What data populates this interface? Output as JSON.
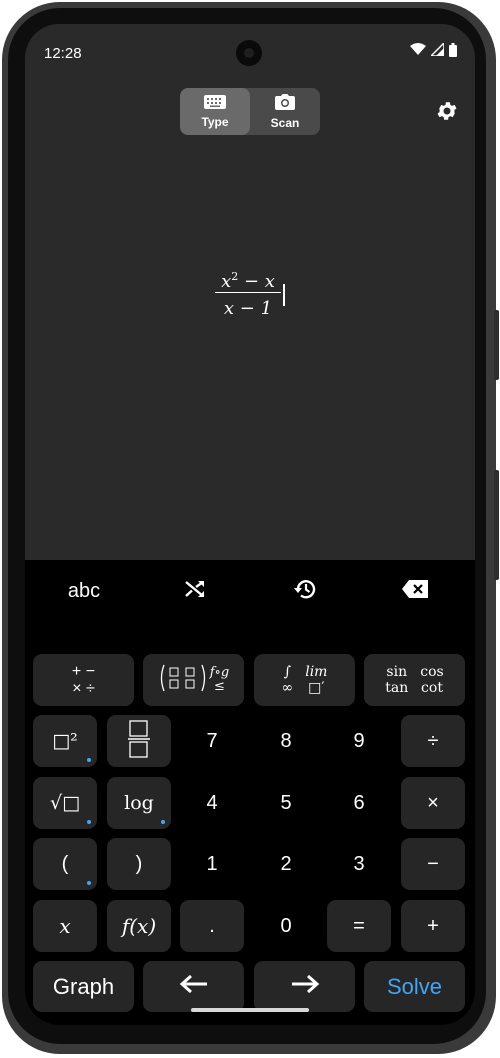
{
  "status": {
    "time": "12:28"
  },
  "modes": {
    "type_label": "Type",
    "scan_label": "Scan"
  },
  "expression": {
    "numerator": "x² − x",
    "numerator_base": "x",
    "numerator_exp": "2",
    "numerator_rest": " − x",
    "denominator": "x − 1"
  },
  "toolbar": {
    "abc_label": "abc"
  },
  "categories": {
    "operators": {
      "line1": "+ −",
      "line2": "× ÷"
    },
    "matrix_extra": "f∘g",
    "matrix_le": "≤",
    "calculus": {
      "integral": "∫",
      "lim": "lim",
      "infinity": "∞",
      "prime": "□′"
    },
    "trig": {
      "sin": "sin",
      "cos": "cos",
      "tan": "tan",
      "cot": "cot"
    }
  },
  "keys": {
    "square": "□²",
    "sqrt": "√□",
    "log": "log",
    "open_paren": "(",
    "close_paren": ")",
    "x": "x",
    "fx": "f(x)",
    "seven": "7",
    "eight": "8",
    "nine": "9",
    "four": "4",
    "five": "5",
    "six": "6",
    "one": "1",
    "two": "2",
    "three": "3",
    "dot": ".",
    "zero": "0",
    "equals": "=",
    "divide": "÷",
    "multiply": "×",
    "minus": "−",
    "plus": "+",
    "graph": "Graph",
    "left": "←",
    "right": "→",
    "solve": "Solve"
  },
  "colors": {
    "accent": "#42a5f5",
    "screen_bg": "#2a2a2a",
    "key_bg": "#262626",
    "keyboard_bg": "#000000"
  }
}
